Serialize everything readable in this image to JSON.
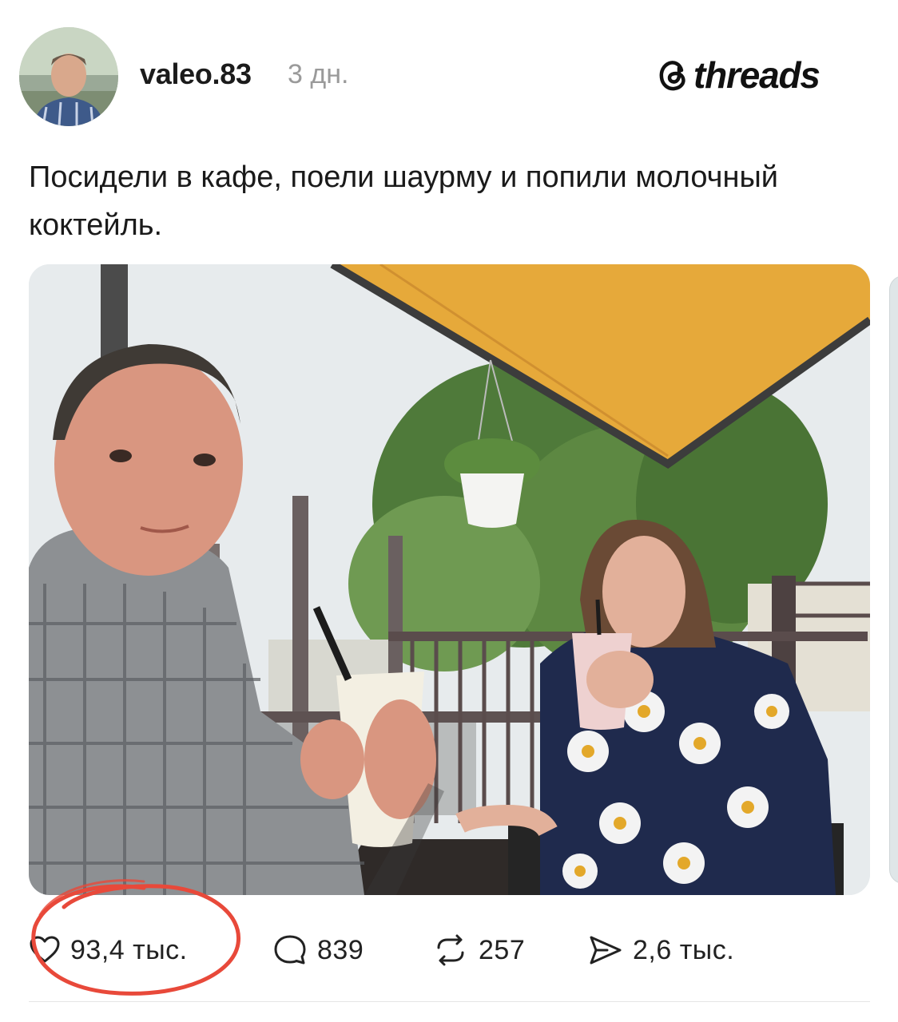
{
  "post": {
    "username": "valeo.83",
    "time": "3 дн.",
    "text": "Посидели в кафе, поели шаурму и попили молочный коктейль."
  },
  "brand": {
    "logo_text": "threads"
  },
  "actions": {
    "likes": "93,4 тыс.",
    "comments": "839",
    "reposts": "257",
    "shares": "2,6 тыс."
  },
  "icons": {
    "like": "heart-icon",
    "comment": "comment-bubble-icon",
    "repost": "repost-icon",
    "share": "send-icon",
    "logo": "threads-logo-icon"
  },
  "colors": {
    "annotation": "#e8493a",
    "canopy": "#e6a93a",
    "muted_text": "#9a9a9a"
  }
}
